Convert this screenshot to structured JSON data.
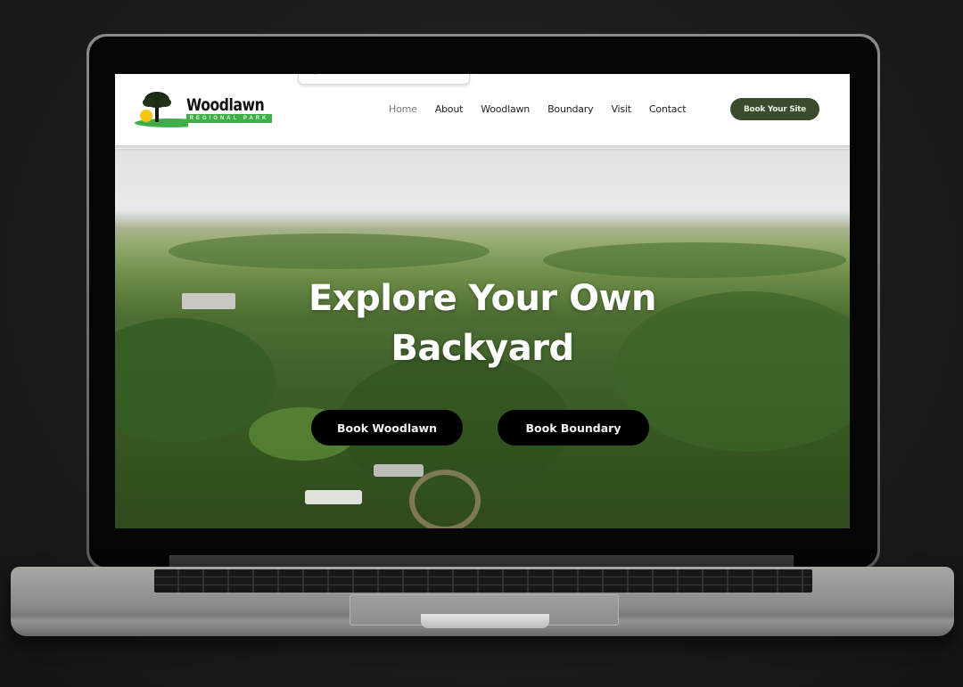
{
  "site": {
    "logo": {
      "name": "Woodlawn",
      "tagline": "REGIONAL PARK"
    },
    "popup_fragment_text": "...",
    "nav": [
      {
        "label": "Home",
        "active": true
      },
      {
        "label": "About",
        "active": false
      },
      {
        "label": "Woodlawn",
        "active": false
      },
      {
        "label": "Boundary",
        "active": false
      },
      {
        "label": "Visit",
        "active": false
      },
      {
        "label": "Contact",
        "active": false
      }
    ],
    "cta_label": "Book Your Site",
    "hero": {
      "title_line1": "Explore Your Own",
      "title_line2": "Backyard",
      "buttons": [
        {
          "label": "Book Woodlawn"
        },
        {
          "label": "Book Boundary"
        }
      ]
    },
    "colors": {
      "brand_green": "#3a4c2c",
      "logo_green": "#3fae48",
      "hero_button": "#000000"
    }
  }
}
